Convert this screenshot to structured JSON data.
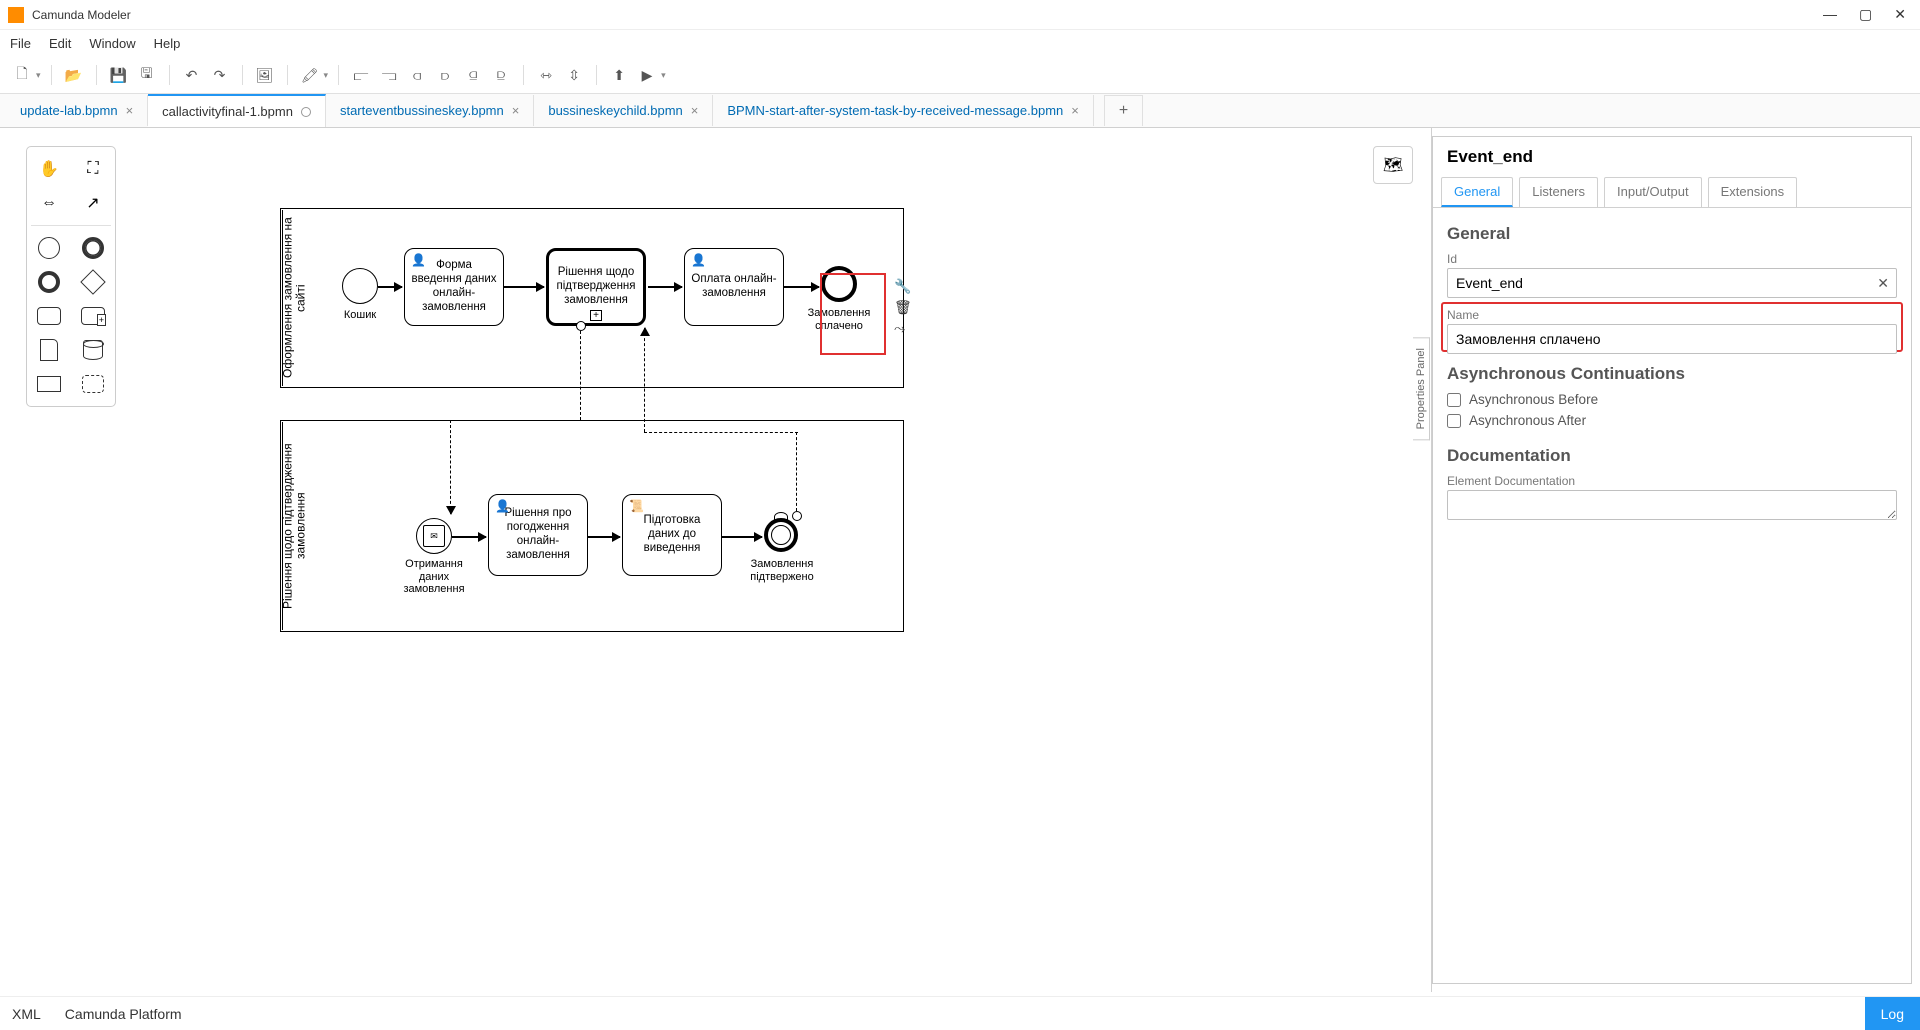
{
  "app": {
    "title": "Camunda Modeler"
  },
  "menu": [
    "File",
    "Edit",
    "Window",
    "Help"
  ],
  "tabs": [
    {
      "label": "update-lab.bpmn",
      "active": false,
      "dirty": false
    },
    {
      "label": "callactivityfinal-1.bpmn",
      "active": true,
      "dirty": true
    },
    {
      "label": "starteventbussineskey.bpmn",
      "active": false,
      "dirty": false
    },
    {
      "label": "bussineskeychild.bpmn",
      "active": false,
      "dirty": false
    },
    {
      "label": "BPMN-start-after-system-task-by-received-message.bpmn",
      "active": false,
      "dirty": false
    }
  ],
  "diagram": {
    "pool1_label": "Оформлення замовлення на сайті",
    "start1_label": "Кошик",
    "task1": "Форма введення даних онлайн-замовлення",
    "task2": "Рішення щодо підтвердження замовлення",
    "task3": "Оплата онлайн-замовлення",
    "end1_label": "Замовлення сплачено",
    "pool2_label": "Рішення щодо підтвердження замовлення",
    "start2_label": "Отримання даних замовлення",
    "task4": "Рішення про погодження онлайн-замовлення",
    "task5": "Підготовка даних до виведення",
    "end2_label": "Замовлення підтвержено"
  },
  "props": {
    "title": "Event_end",
    "tabs": [
      "General",
      "Listeners",
      "Input/Output",
      "Extensions"
    ],
    "section1": "General",
    "id_label": "Id",
    "id_value": "Event_end",
    "name_label": "Name",
    "name_value": "Замовлення сплачено",
    "section2": "Asynchronous Continuations",
    "async_before": "Asynchronous Before",
    "async_after": "Asynchronous After",
    "section3": "Documentation",
    "doc_label": "Element Documentation",
    "handle": "Properties Panel"
  },
  "status": {
    "left1": "XML",
    "left2": "Camunda Platform",
    "log": "Log"
  }
}
